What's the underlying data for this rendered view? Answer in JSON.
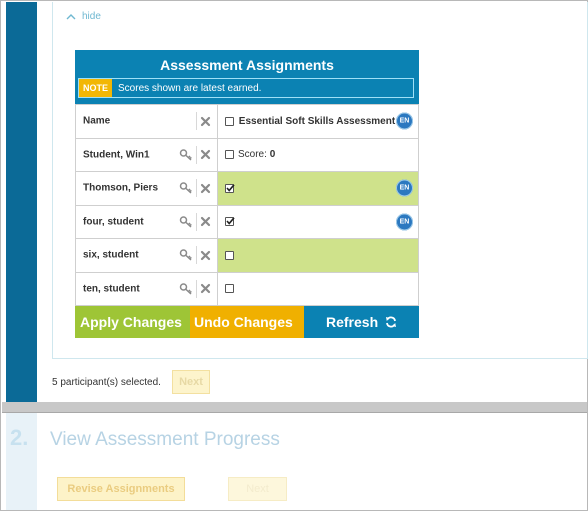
{
  "step1": {
    "hide_label": "hide",
    "widget": {
      "title": "Assessment Assignments",
      "note_badge": "NOTE",
      "note_text": "Scores shown are latest earned.",
      "header": {
        "name_label": "Name",
        "assessment_label": "Essential Soft Skills Assessment",
        "language_badge": "EN"
      },
      "rows": [
        {
          "name": "Student, Win1",
          "checked": false,
          "highlight": false,
          "score_label": "Score:",
          "score_value": "0",
          "language_badge": ""
        },
        {
          "name": "Thomson, Piers",
          "checked": true,
          "highlight": true,
          "score_label": "",
          "score_value": "",
          "language_badge": "EN"
        },
        {
          "name": "four, student",
          "checked": true,
          "highlight": false,
          "score_label": "",
          "score_value": "",
          "language_badge": "EN"
        },
        {
          "name": "six, student",
          "checked": false,
          "highlight": true,
          "score_label": "",
          "score_value": "",
          "language_badge": ""
        },
        {
          "name": "ten, student",
          "checked": false,
          "highlight": false,
          "score_label": "",
          "score_value": "",
          "language_badge": ""
        }
      ],
      "buttons": {
        "apply_label": "Apply Changes",
        "undo_label": "Undo Changes",
        "refresh_label": "Refresh"
      }
    },
    "participants_selected": "5 participant(s) selected.",
    "next_label": "Next"
  },
  "step2": {
    "number": "2.",
    "title": "View Assessment Progress",
    "revise_label": "Revise Assignments",
    "next_label": "Next"
  },
  "colors": {
    "step_bar": "#0b6a97",
    "header_blue": "#0b82b3",
    "apply_green": "#9ec536",
    "undo_yellow": "#f0b000",
    "row_highlight": "#cfe28b"
  }
}
